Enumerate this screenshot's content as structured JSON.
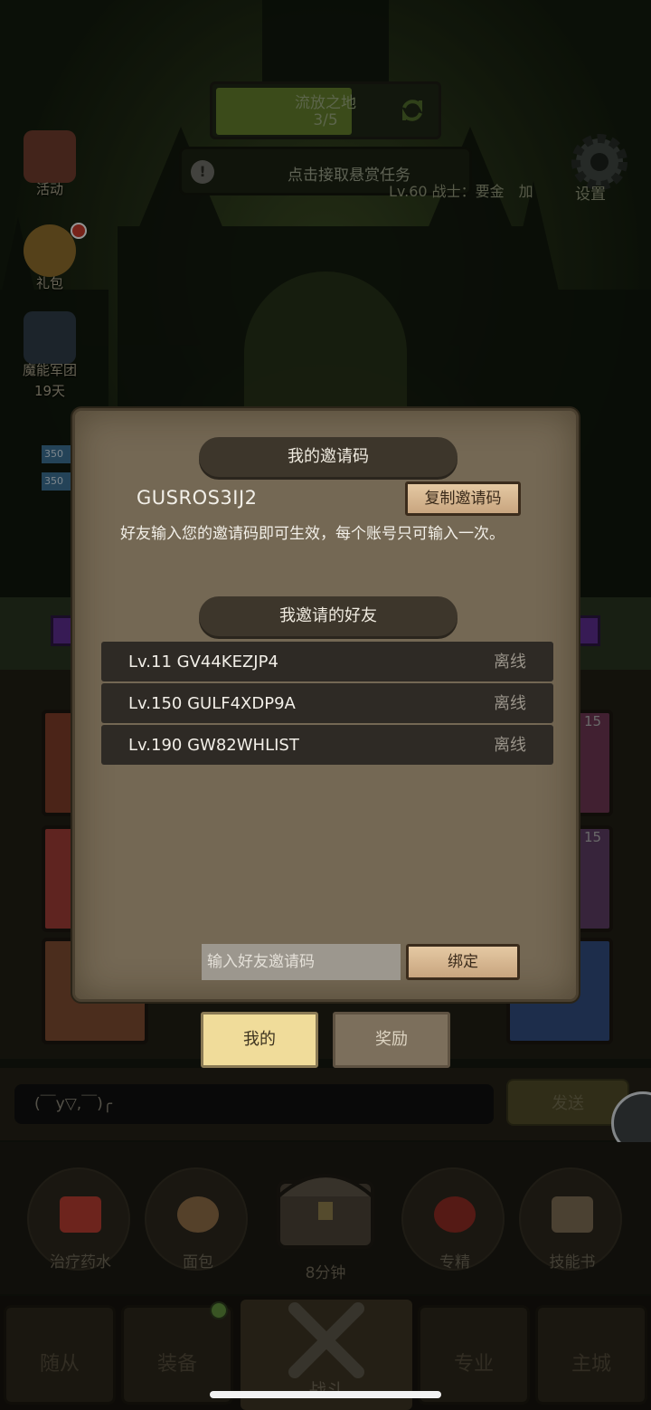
{
  "hud": {
    "stage_name": "流放之地",
    "stage_progress": "3/5",
    "quest_text": "点击接取悬赏任务",
    "player_line": "Lv.60 战士：要金　加",
    "settings_label": "设置"
  },
  "side_menu": [
    {
      "label": "活动",
      "icon": "scroll-icon"
    },
    {
      "label": "礼包",
      "icon": "giftbag-icon"
    },
    {
      "label": "魔能军团",
      "icon": "legion-icon"
    }
  ],
  "side_menu_timer": "19天",
  "mini_bars": [
    "350",
    "350"
  ],
  "cards": {
    "count_a": "15",
    "count_b": "15"
  },
  "invite_modal": {
    "my_code_title": "我的邀请码",
    "my_code": "GUSROS3IJ2",
    "copy_button": "复制邀请码",
    "description": "好友输入您的邀请码即可生效，每个账号只可输入一次。",
    "friends_title": "我邀请的好友",
    "friends": [
      {
        "name": "Lv.11 GV44KEZJP4",
        "status": "离线"
      },
      {
        "name": "Lv.150 GULF4XDP9A",
        "status": "离线"
      },
      {
        "name": "Lv.190 GW82WHLIST",
        "status": "离线"
      }
    ],
    "input_placeholder": "输入好友邀请码",
    "bind_button": "绑定",
    "tabs": [
      "我的",
      "奖励"
    ]
  },
  "chat": {
    "input_value": "(￣y▽,￣)╭",
    "send_label": "发送"
  },
  "consumables": [
    {
      "label": "治疗药水",
      "icon": "potion-icon",
      "color": "#b03a30"
    },
    {
      "label": "面包",
      "icon": "bread-icon",
      "color": "#8a6a45"
    },
    {
      "label": "专精",
      "icon": "mastery-icon",
      "color": "#8a2a22"
    },
    {
      "label": "技能书",
      "icon": "skillbook-icon",
      "color": "#7a6a52"
    }
  ],
  "chest_timer": "8分钟",
  "bottom_nav": [
    "随从",
    "装备",
    "战斗",
    "专业",
    "主城"
  ],
  "colors": {
    "modal_bg": "#746854",
    "banner_bg": "#3d362b",
    "row_bg": "#2e2a25",
    "wood_button": "#d9b892",
    "active_tab": "#f0dc9a"
  }
}
